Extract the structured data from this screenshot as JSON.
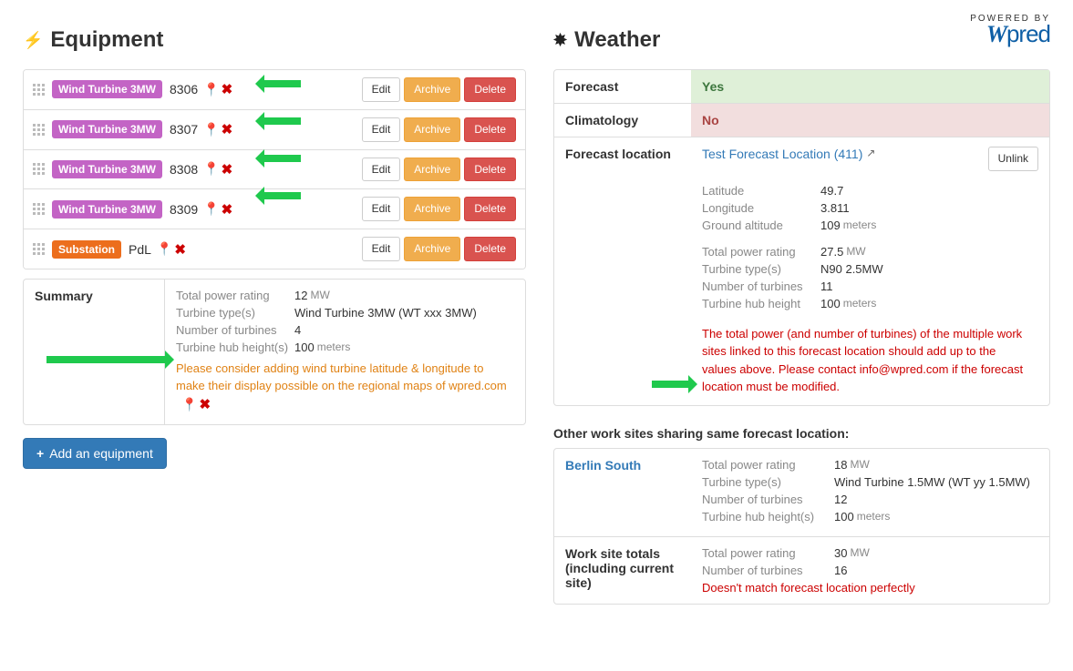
{
  "logo": {
    "powered_by": "POWERED BY",
    "brand": "Wpred"
  },
  "equipment": {
    "title": "Equipment",
    "rows": [
      {
        "type_label": "Wind Turbine 3MW",
        "type_class": "turbine",
        "code": "8306"
      },
      {
        "type_label": "Wind Turbine 3MW",
        "type_class": "turbine",
        "code": "8307"
      },
      {
        "type_label": "Wind Turbine 3MW",
        "type_class": "turbine",
        "code": "8308"
      },
      {
        "type_label": "Wind Turbine 3MW",
        "type_class": "turbine",
        "code": "8309"
      },
      {
        "type_label": "Substation",
        "type_class": "substation",
        "code": "PdL"
      }
    ],
    "buttons": {
      "edit": "Edit",
      "archive": "Archive",
      "delete": "Delete"
    },
    "summary": {
      "label": "Summary",
      "total_power_rating": {
        "k": "Total power rating",
        "v": "12",
        "unit": "MW"
      },
      "turbine_types": {
        "k": "Turbine type(s)",
        "v": "Wind Turbine 3MW (WT xxx 3MW)"
      },
      "number_of_turbines": {
        "k": "Number of turbines",
        "v": "4"
      },
      "turbine_hub_heights": {
        "k": "Turbine hub height(s)",
        "v": "100",
        "unit": "meters"
      },
      "hint": "Please consider adding wind turbine latitude & longitude to make their display possible on the regional maps of wpred.com"
    },
    "add_button": "Add an equipment"
  },
  "weather": {
    "title": "Weather",
    "forecast": {
      "label": "Forecast",
      "value": "Yes"
    },
    "climatology": {
      "label": "Climatology",
      "value": "No"
    },
    "forecast_location": {
      "label": "Forecast location",
      "link": "Test Forecast Location (411)",
      "unlink": "Unlink",
      "latitude": {
        "k": "Latitude",
        "v": "49.7"
      },
      "longitude": {
        "k": "Longitude",
        "v": "3.811"
      },
      "ground_altitude": {
        "k": "Ground altitude",
        "v": "109",
        "unit": "meters"
      },
      "total_power_rating": {
        "k": "Total power rating",
        "v": "27.5",
        "unit": "MW"
      },
      "turbine_types": {
        "k": "Turbine type(s)",
        "v": "N90 2.5MW"
      },
      "number_of_turbines": {
        "k": "Number of turbines",
        "v": "11"
      },
      "turbine_hub_height": {
        "k": "Turbine hub height",
        "v": "100",
        "unit": "meters"
      },
      "note": "The total power (and number of turbines) of the multiple work sites linked to this forecast location should add up to the values above. Please contact info@wpred.com if the forecast location must be modified."
    },
    "other_sites_heading": "Other work sites sharing same forecast location:",
    "other_site": {
      "name": "Berlin South",
      "total_power_rating": {
        "k": "Total power rating",
        "v": "18",
        "unit": "MW"
      },
      "turbine_types": {
        "k": "Turbine type(s)",
        "v": "Wind Turbine 1.5MW (WT yy 1.5MW)"
      },
      "number_of_turbines": {
        "k": "Number of turbines",
        "v": "12"
      },
      "turbine_hub_heights": {
        "k": "Turbine hub height(s)",
        "v": "100",
        "unit": "meters"
      }
    },
    "totals": {
      "label": "Work site totals (including current site)",
      "total_power_rating": {
        "k": "Total power rating",
        "v": "30",
        "unit": "MW"
      },
      "number_of_turbines": {
        "k": "Number of turbines",
        "v": "16"
      },
      "mismatch": "Doesn't match forecast location perfectly"
    }
  }
}
